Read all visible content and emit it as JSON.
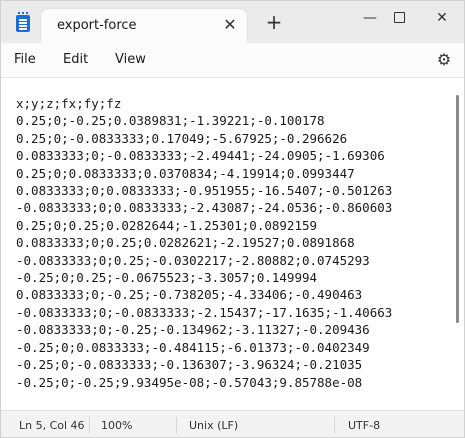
{
  "window": {
    "tab_title": "export-force",
    "close_glyph": "✕",
    "new_tab_glyph": "+",
    "min_glyph": "—",
    "close_window_glyph": "✕"
  },
  "menu": {
    "file": "File",
    "edit": "Edit",
    "view": "View",
    "settings_glyph": "⚙"
  },
  "editor": {
    "lines": [
      "x;y;z;fx;fy;fz",
      "0.25;0;-0.25;0.0389831;-1.39221;-0.100178",
      "0.25;0;-0.0833333;0.17049;-5.67925;-0.296626",
      "0.0833333;0;-0.0833333;-2.49441;-24.0905;-1.69306",
      "0.25;0;0.0833333;0.0370834;-4.19914;0.0993447",
      "0.0833333;0;0.0833333;-0.951955;-16.5407;-0.501263",
      "-0.0833333;0;0.0833333;-2.43087;-24.0536;-0.860603",
      "0.25;0;0.25;0.0282644;-1.25301;0.0892159",
      "0.0833333;0;0.25;0.0282621;-2.19527;0.0891868",
      "-0.0833333;0;0.25;-0.0302217;-2.80882;0.0745293",
      "-0.25;0;0.25;-0.0675523;-3.3057;0.149994",
      "0.0833333;0;-0.25;-0.738205;-4.33406;-0.490463",
      "-0.0833333;0;-0.0833333;-2.15437;-17.1635;-1.40663",
      "-0.0833333;0;-0.25;-0.134962;-3.11327;-0.209436",
      "-0.25;0;0.0833333;-0.484115;-6.01373;-0.0402349",
      "-0.25;0;-0.0833333;-0.136307;-3.96324;-0.21035",
      "-0.25;0;-0.25;9.93495e-08;-0.57043;9.85788e-08"
    ]
  },
  "status": {
    "position": "Ln 5, Col 46",
    "zoom": "100%",
    "line_ending": "Unix (LF)",
    "encoding": "UTF-8"
  },
  "colors": {
    "app_icon": "#1a6fd6",
    "titlebar": "#ebebeb",
    "editor_bg": "#ffffff"
  }
}
